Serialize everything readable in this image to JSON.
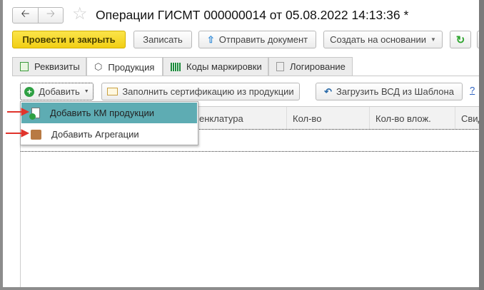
{
  "title": "Операции ГИСМТ 000000014 от 05.08.2022 14:13:36 *",
  "toolbar": {
    "post_close": "Провести и закрыть",
    "save": "Записать",
    "send": "Отправить документ",
    "create_based": "Создать на основании"
  },
  "tabs": [
    "Реквизиты",
    "Продукция",
    "Коды маркировки",
    "Логирование"
  ],
  "sub_toolbar": {
    "add": "Добавить",
    "fill_cert": "Заполнить сертификацию из продукции",
    "load_vsd": "Загрузить ВСД из Шаблона",
    "help": "?"
  },
  "table": {
    "columns": [
      "енклатура",
      "Кол-во",
      "Кол-во влож.",
      "Свид"
    ]
  },
  "menu": {
    "items": [
      "Добавить КМ продукции",
      "Добавить Агрегации"
    ]
  },
  "colors": {
    "accent_yellow": "#f2cf14",
    "menu_highlight": "#5eacb3",
    "arrow": "#e0342c"
  }
}
